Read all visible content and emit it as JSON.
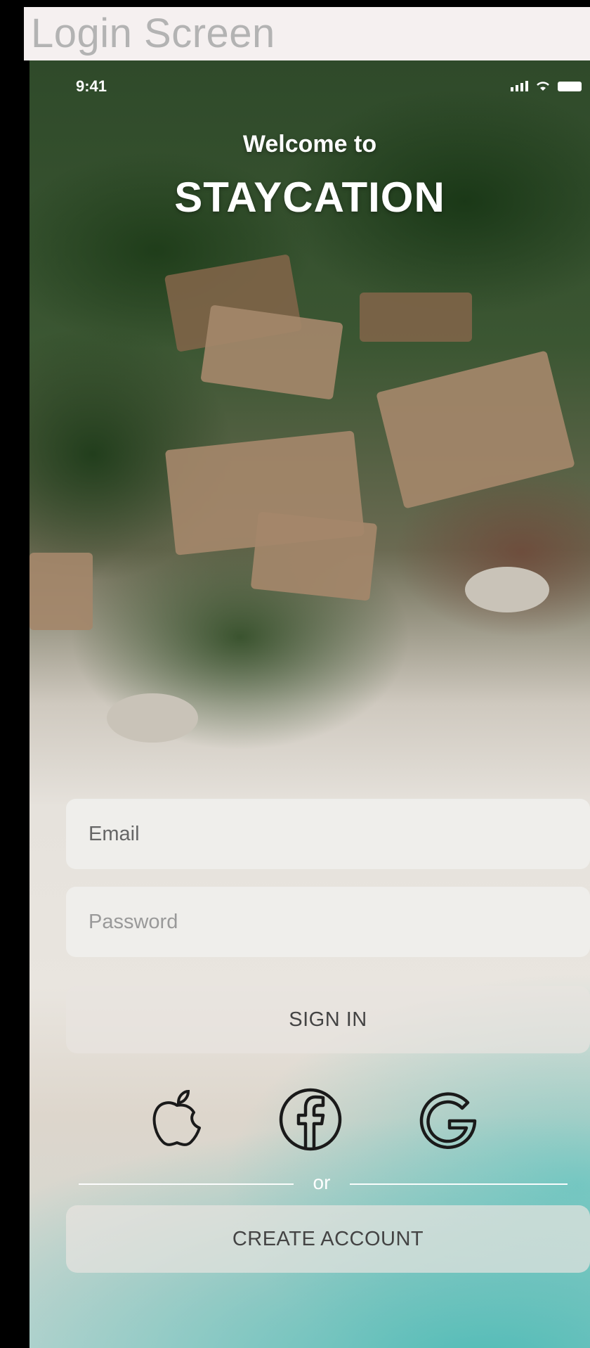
{
  "window": {
    "title": "Login Screen"
  },
  "status_bar": {
    "time": "9:41"
  },
  "header": {
    "greeting": "Welcome to",
    "brand": "STAYCATION"
  },
  "form": {
    "email_placeholder": "Email",
    "password_placeholder": "Password",
    "sign_in_label": "SIGN IN"
  },
  "social": {
    "icons": [
      "apple-icon",
      "facebook-icon",
      "google-icon"
    ]
  },
  "divider": {
    "label": "or"
  },
  "create_account_label": "CREATE ACCOUNT"
}
